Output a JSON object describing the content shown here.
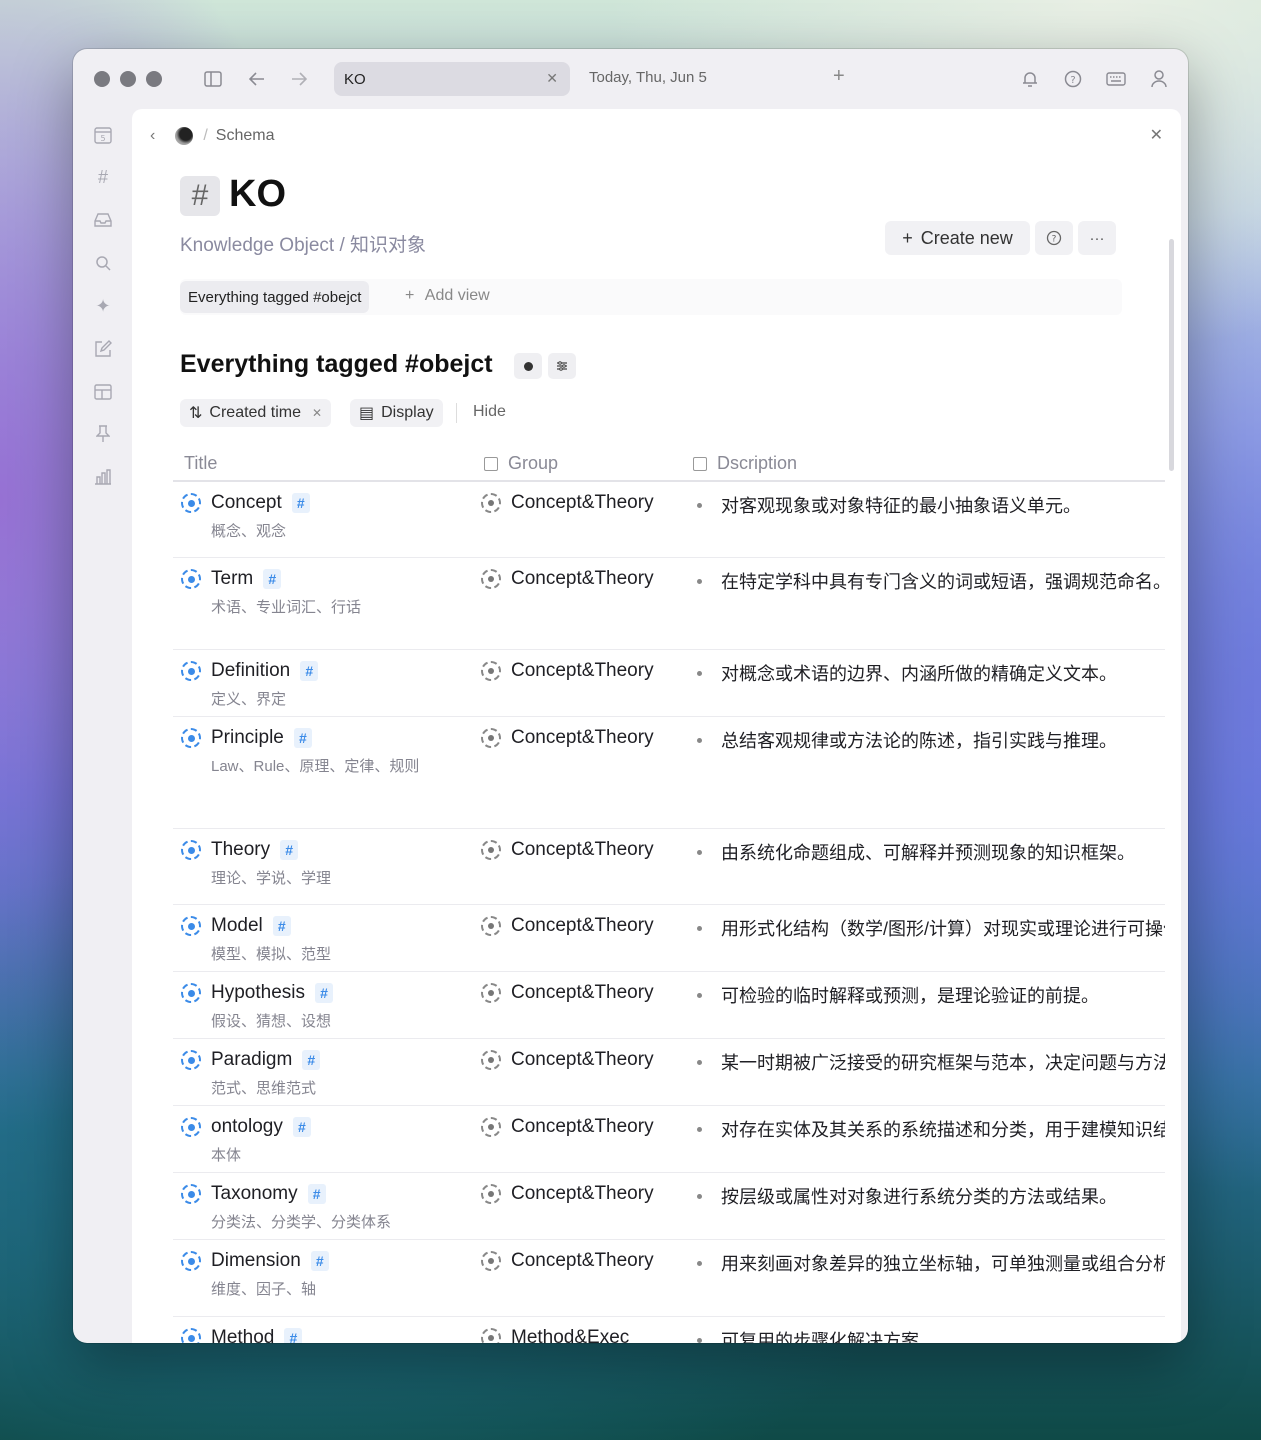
{
  "window": {
    "tabs": [
      {
        "label": "KO",
        "active": true
      },
      {
        "label": "Today, Thu, Jun 5",
        "active": false
      }
    ],
    "toolbar_icons": [
      "sidebar-toggle-icon",
      "back-arrow-icon",
      "forward-arrow-icon",
      "bell-icon",
      "help-icon",
      "keyboard-icon",
      "user-icon"
    ]
  },
  "leftbar": {
    "icons": [
      "calendar-icon",
      "hashtag-icon",
      "inbox-icon",
      "search-icon",
      "sparkle-icon",
      "edit-icon",
      "layout-icon",
      "pin-icon",
      "analytics-icon"
    ]
  },
  "breadcrumb": {
    "item": "Schema"
  },
  "page": {
    "hash": "#",
    "title": "KO",
    "subtitle": "Knowledge Object / 知识对象",
    "create_label": "Create new",
    "create_plus": "+",
    "help_glyph": "?",
    "more_glyph": "···"
  },
  "views": {
    "active": "Everything tagged #obejct",
    "add_label": "Add view",
    "add_plus": "+"
  },
  "view": {
    "title": "Everything tagged #obejct",
    "sort_label": "Created time",
    "sort_icon": "sort-icon",
    "display_label": "Display",
    "hide_label": "Hide"
  },
  "table": {
    "columns": {
      "title": "Title",
      "group": "Group",
      "description": "Dscription"
    },
    "rows": [
      {
        "title": "Concept",
        "alias": "概念、观念",
        "group": "Concept&Theory",
        "description": "对客观现象或对象特征的最小抽象语义单元。"
      },
      {
        "title": "Term",
        "alias": "术语、专业词汇、行话",
        "group": "Concept&Theory",
        "description": "在特定学科中具有专门含义的词或短语，强调规范命名。"
      },
      {
        "title": "Definition",
        "alias": "定义、界定",
        "group": "Concept&Theory",
        "description": "对概念或术语的边界、内涵所做的精确定义文本。"
      },
      {
        "title": "Principle",
        "alias": "Law、Rule、原理、定律、规则",
        "group": "Concept&Theory",
        "description": "总结客观规律或方法论的陈述，指引实践与推理。"
      },
      {
        "title": "Theory",
        "alias": "理论、学说、学理",
        "group": "Concept&Theory",
        "description": "由系统化命题组成、可解释并预测现象的知识框架。"
      },
      {
        "title": "Model",
        "alias": "模型、模拟、范型",
        "group": "Concept&Theory",
        "description": "用形式化结构（数学/图形/计算）对现实或理论进行可操作的"
      },
      {
        "title": "Hypothesis",
        "alias": "假设、猜想、设想",
        "group": "Concept&Theory",
        "description": "可检验的临时解释或预测，是理论验证的前提。"
      },
      {
        "title": "Paradigm",
        "alias": "范式、思维范式",
        "group": "Concept&Theory",
        "description": "某一时期被广泛接受的研究框架与范本，决定问题与方法"
      },
      {
        "title": "ontology",
        "alias": "本体",
        "group": "Concept&Theory",
        "description": "对存在实体及其关系的系统描述和分类，用于建模知识结构"
      },
      {
        "title": "Taxonomy",
        "alias": "分类法、分类学、分类体系",
        "group": "Concept&Theory",
        "description": "按层级或属性对对象进行系统分类的方法或结果。"
      },
      {
        "title": "Dimension",
        "alias": "维度、因子、轴",
        "group": "Concept&Theory",
        "description": "用来刻画对象差异的独立坐标轴，可单独测量或组合分析"
      },
      {
        "title": "Method",
        "alias": "",
        "group": "Method&Exec",
        "description": "可复用的步骤化解决方案"
      }
    ],
    "tag_glyph": "#"
  }
}
